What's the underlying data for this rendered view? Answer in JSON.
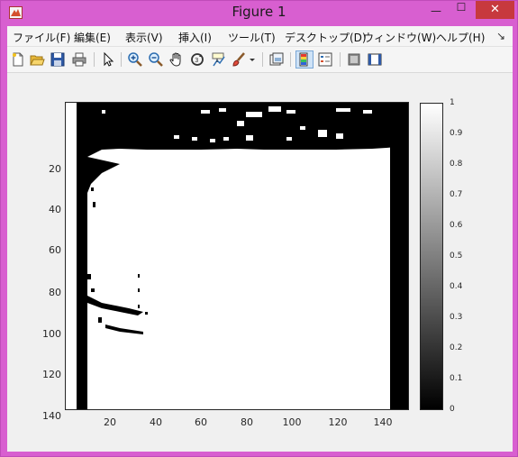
{
  "window": {
    "title": "Figure 1"
  },
  "window_controls": {
    "minimize": "—",
    "maximize": "☐",
    "close": "✕"
  },
  "menu": [
    "ファイル(F)",
    "編集(E)",
    "表示(V)",
    "挿入(I)",
    "ツール(T)",
    "デスクトップ(D)",
    "ウィンドウ(W)",
    "ヘルプ(H)"
  ],
  "menu_more": "↘",
  "toolbar": [
    "new-figure-icon",
    "open-file-icon",
    "save-icon",
    "print-icon",
    "edit-plot-arrow-icon",
    "zoom-in-icon",
    "zoom-out-icon",
    "pan-hand-icon",
    "rotate-3d-icon",
    "data-cursor-icon",
    "brush-icon",
    "brush-dropdown-icon",
    "link-plot-icon",
    "insert-colorbar-icon",
    "insert-legend-icon",
    "hide-plot-tools-icon",
    "show-plot-tools-icon"
  ],
  "axes": {
    "yticks": [
      "20",
      "40",
      "60",
      "80",
      "100",
      "120",
      "140"
    ],
    "xticks": [
      "20",
      "40",
      "60",
      "80",
      "100",
      "120",
      "140"
    ]
  },
  "colorbar": {
    "ticks": [
      "1",
      "0.9",
      "0.8",
      "0.7",
      "0.6",
      "0.5",
      "0.4",
      "0.3",
      "0.2",
      "0.1",
      "0"
    ]
  },
  "image_desc": "binary image"
}
